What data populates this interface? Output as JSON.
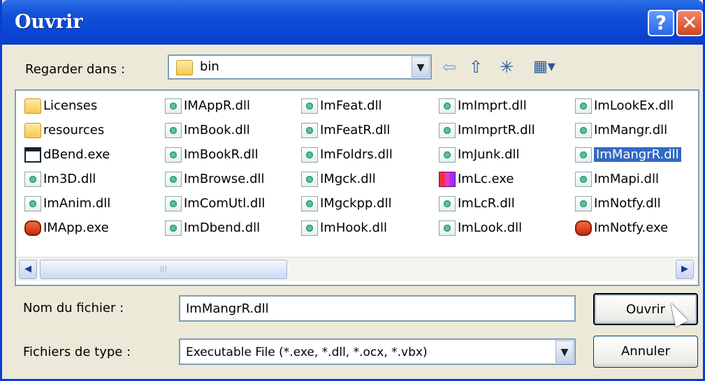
{
  "window": {
    "title": "Ouvrir",
    "help_label": "?",
    "close_label": "✕"
  },
  "look_in": {
    "label": "Regarder dans :",
    "value": "bin"
  },
  "files": [
    {
      "name": "Licenses",
      "icon": "folder-icon"
    },
    {
      "name": "resources",
      "icon": "folder-icon"
    },
    {
      "name": "dBend.exe",
      "icon": "exe-icon"
    },
    {
      "name": "Im3D.dll",
      "icon": "dll-icon"
    },
    {
      "name": "ImAnim.dll",
      "icon": "dll-icon"
    },
    {
      "name": "IMApp.exe",
      "icon": "app-exe-icon"
    },
    {
      "name": "IMAppR.dll",
      "icon": "dll-icon"
    },
    {
      "name": "ImBook.dll",
      "icon": "dll-icon"
    },
    {
      "name": "ImBookR.dll",
      "icon": "dll-icon"
    },
    {
      "name": "ImBrowse.dll",
      "icon": "dll-icon"
    },
    {
      "name": "ImComUtl.dll",
      "icon": "dll-icon"
    },
    {
      "name": "ImDbend.dll",
      "icon": "dll-icon"
    },
    {
      "name": "ImFeat.dll",
      "icon": "dll-icon"
    },
    {
      "name": "ImFeatR.dll",
      "icon": "dll-icon"
    },
    {
      "name": "ImFoldrs.dll",
      "icon": "dll-icon"
    },
    {
      "name": "IMgck.dll",
      "icon": "dll-icon"
    },
    {
      "name": "IMgckpp.dll",
      "icon": "dll-icon"
    },
    {
      "name": "ImHook.dll",
      "icon": "dll-icon"
    },
    {
      "name": "ImImprt.dll",
      "icon": "dll-icon"
    },
    {
      "name": "ImImprtR.dll",
      "icon": "dll-icon"
    },
    {
      "name": "ImJunk.dll",
      "icon": "dll-icon"
    },
    {
      "name": "ImLc.exe",
      "icon": "lc-exe-icon"
    },
    {
      "name": "ImLcR.dll",
      "icon": "dll-icon"
    },
    {
      "name": "ImLook.dll",
      "icon": "dll-icon"
    },
    {
      "name": "ImLookEx.dll",
      "icon": "dll-icon"
    },
    {
      "name": "ImMangr.dll",
      "icon": "dll-icon"
    },
    {
      "name": "ImMangrR.dll",
      "icon": "dll-icon",
      "selected": true
    },
    {
      "name": "ImMapi.dll",
      "icon": "dll-icon"
    },
    {
      "name": "ImNotfy.dll",
      "icon": "dll-icon"
    },
    {
      "name": "ImNotfy.exe",
      "icon": "app-exe-icon"
    }
  ],
  "filename": {
    "label": "Nom du fichier :",
    "value": "ImMangrR.dll"
  },
  "filetype": {
    "label": "Fichiers de type :",
    "value": "Executable File (*.exe, *.dll, *.ocx, *.vbx)"
  },
  "buttons": {
    "open": "Ouvrir",
    "cancel": "Annuler"
  },
  "colors": {
    "titlebar": "#0a46d4",
    "selection": "#316ac5",
    "dialog_bg": "#ece9d8"
  }
}
